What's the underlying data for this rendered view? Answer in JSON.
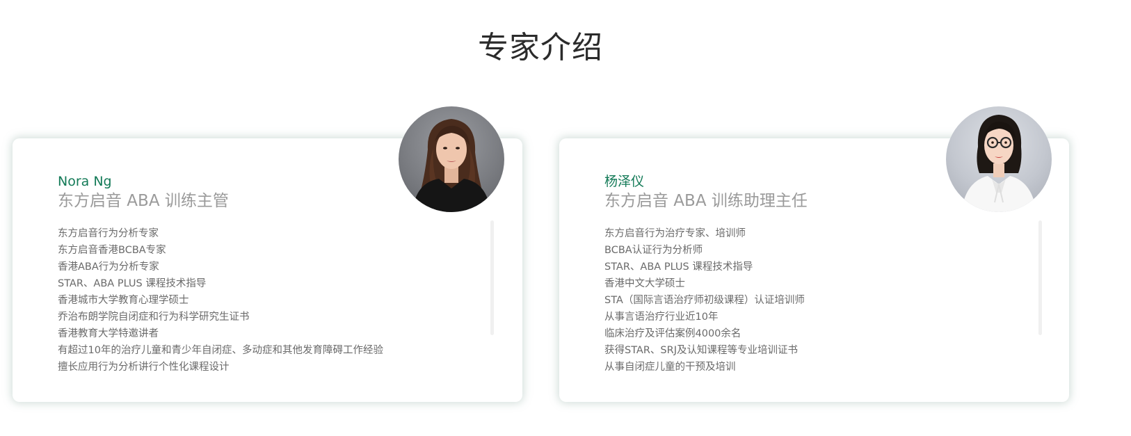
{
  "section": {
    "title": "专家介绍"
  },
  "experts": [
    {
      "name": "Nora Ng",
      "role": "东方启音 ABA 训练主管",
      "credentials": [
        "东方启音行为分析专家",
        "东方启音香港BCBA专家",
        "香港ABA行为分析专家",
        "STAR、ABA PLUS 课程技术指导",
        "香港城市大学教育心理学硕士",
        "乔治布朗学院自闭症和行为科学研究生证书",
        "香港教育大学特邀讲者",
        "有超过10年的治疗儿童和青少年自闭症、多动症和其他发育障碍工作经验",
        "擅长应用行为分析讲行个性化课程设计"
      ]
    },
    {
      "name": "杨泽仪",
      "role": "东方启音 ABA 训练助理主任",
      "credentials": [
        "东方启音行为治疗专家、培训师",
        "BCBA认证行为分析师",
        "STAR、ABA PLUS 课程技术指导",
        "香港中文大学硕士",
        "STA（国际言语治疗师初级课程）认证培训师",
        "从事言语治疗行业近10年",
        "临床治疗及评估案例4000余名",
        "获得STAR、SRJ及认知课程等专业培训证书",
        "从事自闭症儿童的干预及培训"
      ]
    }
  ]
}
